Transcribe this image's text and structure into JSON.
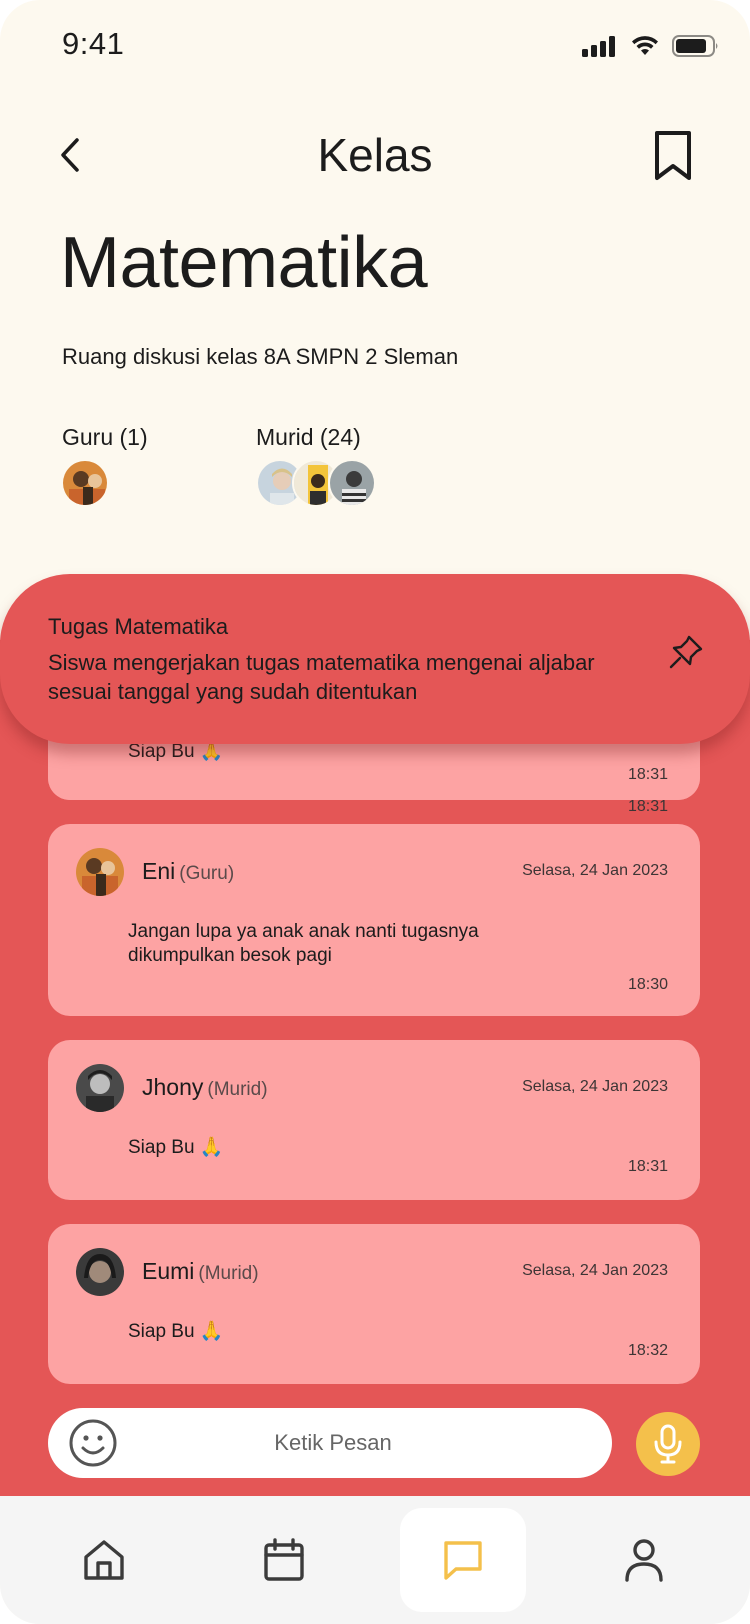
{
  "status_bar": {
    "time": "9:41"
  },
  "header": {
    "title": "Kelas"
  },
  "class": {
    "title": "Matematika",
    "description": "Ruang diskusi kelas 8A SMPN 2 Sleman",
    "teachers_label": "Guru (1)",
    "students_label": "Murid (24)"
  },
  "pinned": {
    "title": "Tugas Matematika",
    "body": "Siswa mengerjakan tugas matematika mengenai aljabar sesuai tanggal yang sudah ditentukan"
  },
  "messages": [
    {
      "name": "",
      "role": "",
      "date": "",
      "text": "Siap Bu 🙏",
      "time": "18:31"
    },
    {
      "name": "Eni",
      "role": "(Guru)",
      "date": "Selasa, 24 Jan 2023",
      "text": "Jangan lupa ya anak anak nanti tugasnya dikumpulkan besok pagi",
      "time": "18:30"
    },
    {
      "name": "Jhony",
      "role": "(Murid)",
      "date": "Selasa, 24 Jan 2023",
      "text": "Siap Bu 🙏",
      "time": "18:31"
    },
    {
      "name": "Eumi",
      "role": "(Murid)",
      "date": "Selasa, 24 Jan 2023",
      "text": "Siap Bu 🙏",
      "time": "18:32"
    }
  ],
  "composer": {
    "placeholder": "Ketik Pesan"
  },
  "nav": {
    "items": [
      {
        "icon": "home-icon",
        "active": false
      },
      {
        "icon": "calendar-icon",
        "active": false
      },
      {
        "icon": "chat-icon",
        "active": true
      },
      {
        "icon": "profile-icon",
        "active": false
      }
    ]
  },
  "colors": {
    "background": "#fdf9ef",
    "panel": "#e45656",
    "card": "#fda3a3",
    "accent": "#f4c04b"
  }
}
